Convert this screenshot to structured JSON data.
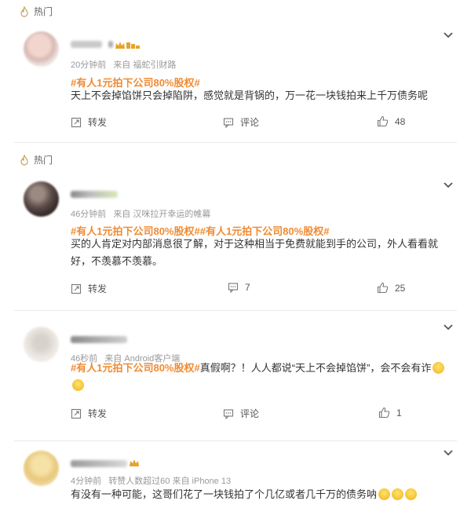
{
  "comments": [
    {
      "hot_label": "热门",
      "time": "20分钟前",
      "source": "来自 福蛇引财路",
      "tags": "#有人1元拍下公司80%股权#",
      "text": "天上不会掉馅饼只会掉陷阱，感觉就是背锅的，万一花一块钱拍来上千万债务呢",
      "repost_label": "转发",
      "comment_label": "评论",
      "like_count": "48"
    },
    {
      "hot_label": "热门",
      "time": "46分钟前",
      "source": "来自 汉咪拉开幸运的帷幕",
      "tags": "#有人1元拍下公司80%股权##有人1元拍下公司80%股权#",
      "text": "买的人肯定对内部消息很了解，对于这种相当于免费就能到手的公司，外人看看就好，不羡慕不羡慕。",
      "repost_label": "转发",
      "comment_count": "7",
      "like_count": "25"
    },
    {
      "time": "46秒前",
      "source": "来自 Android客户端",
      "tag_inline": "#有人1元拍下公司80%股权#",
      "text_after_tag": "真假啊？！人人都说“天上不会掉馅饼”，会不会有诈",
      "repost_label": "转发",
      "comment_label": "评论",
      "like_count": "1"
    },
    {
      "time": "4分钟前",
      "source": "转赞人数超过60  来自 iPhone 13",
      "text": "有没有一种可能，这哥们花了一块钱拍了个几亿或者几千万的债务呐"
    }
  ],
  "colors": {
    "accent": "#f08b33",
    "meta": "#999999",
    "text": "#333333"
  },
  "icons": [
    "fire-icon",
    "chevron-down-icon",
    "repost-icon",
    "comment-icon",
    "like-icon",
    "crown-icon",
    "surprised-emoji-icon",
    "laugh-emoji-icon"
  ]
}
